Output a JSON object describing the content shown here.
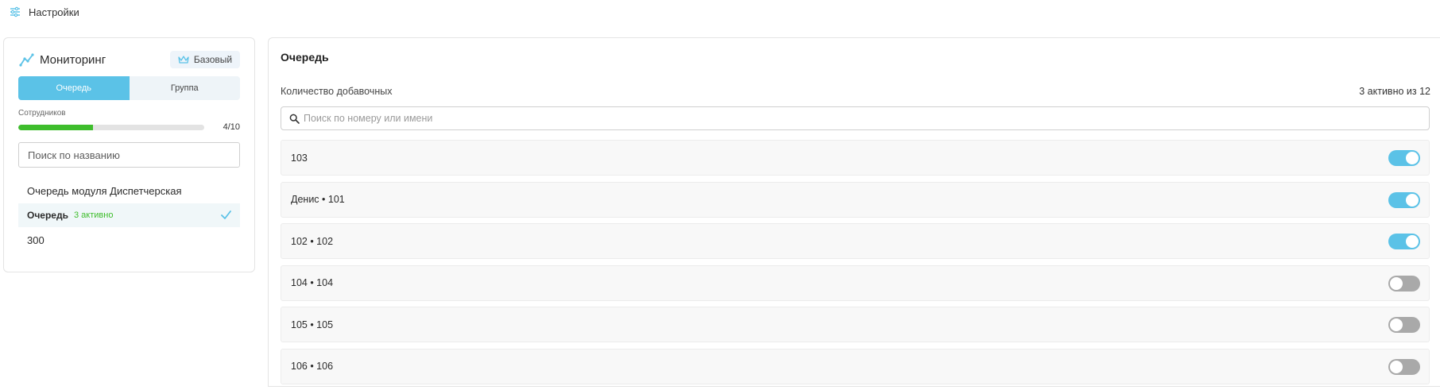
{
  "topbar": {
    "title": "Настройки",
    "icon": "sliders-icon"
  },
  "monitoring": {
    "title": "Мониторинг",
    "icon": "chart-line-icon",
    "plan_badge": {
      "label": "Базовый",
      "icon": "crown-icon"
    },
    "tabs": [
      {
        "label": "Очередь",
        "active": true
      },
      {
        "label": "Группа",
        "active": false
      }
    ],
    "employees": {
      "label": "Сотрудников",
      "count_text": "4/10",
      "used": 4,
      "total": 10
    },
    "search_placeholder": "Поиск по названию",
    "queues": [
      {
        "name": "Очередь модуля Диспетчерская",
        "active_text": "",
        "selected": false
      },
      {
        "name": "Очередь",
        "active_text": "3 активно",
        "selected": true
      },
      {
        "name": "300",
        "active_text": "",
        "selected": false
      }
    ]
  },
  "queue_panel": {
    "title": "Очередь",
    "extensions_label": "Количество добавочных",
    "extensions_count_text": "3 активно из 12",
    "search_placeholder": "Поиск по номеру или имени",
    "extensions": [
      {
        "label": "103",
        "enabled": true
      },
      {
        "label": "Денис • 101",
        "enabled": true
      },
      {
        "label": "102 • 102",
        "enabled": true
      },
      {
        "label": "104 • 104",
        "enabled": false
      },
      {
        "label": "105 • 105",
        "enabled": false
      },
      {
        "label": "106 • 106",
        "enabled": false
      }
    ]
  },
  "colors": {
    "accent": "#5bc2e7",
    "success": "#3ebd2c",
    "toggle_off": "#a9a9a9"
  }
}
